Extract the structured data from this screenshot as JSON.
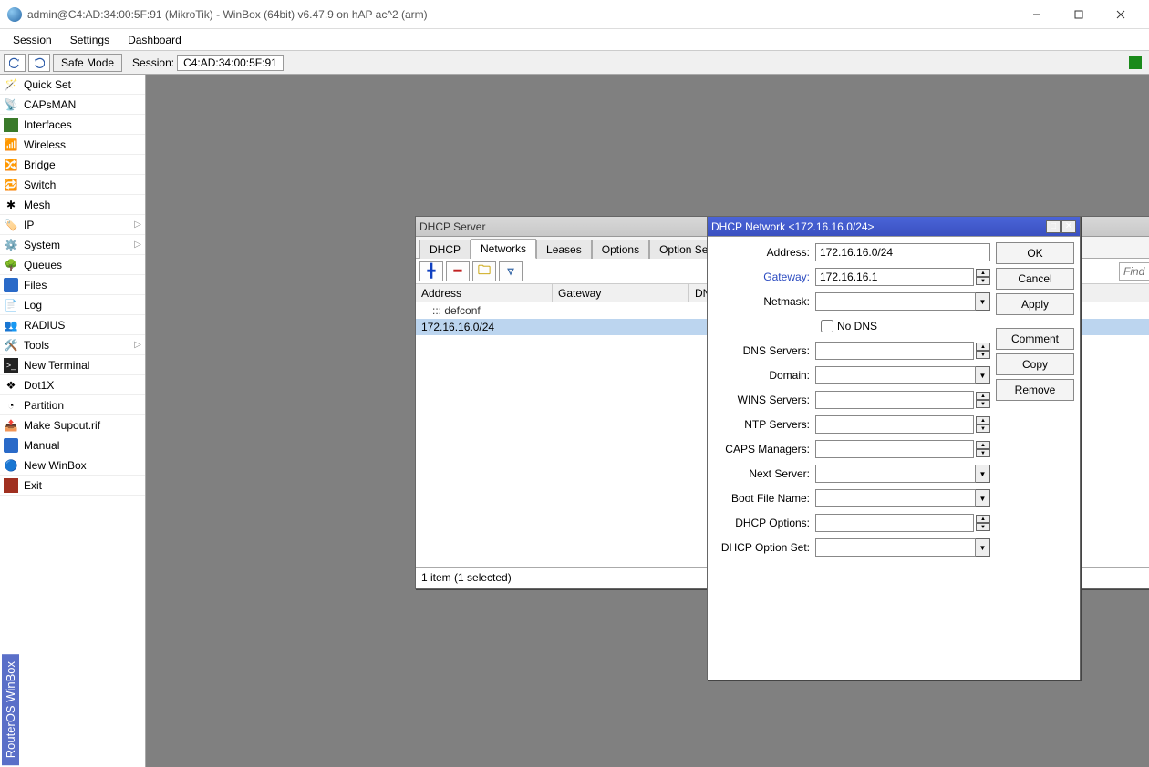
{
  "titlebar": {
    "title": "admin@C4:AD:34:00:5F:91 (MikroTik) - WinBox (64bit) v6.47.9 on hAP ac^2 (arm)"
  },
  "menubar": {
    "session": "Session",
    "settings": "Settings",
    "dashboard": "Dashboard"
  },
  "toolbar": {
    "safe_mode": "Safe Mode",
    "session_label": "Session:",
    "session_value": "C4:AD:34:00:5F:91"
  },
  "sidebar": {
    "items": [
      "Quick Set",
      "CAPsMAN",
      "Interfaces",
      "Wireless",
      "Bridge",
      "Switch",
      "Mesh",
      "IP",
      "System",
      "Queues",
      "Files",
      "Log",
      "RADIUS",
      "Tools",
      "New Terminal",
      "Dot1X",
      "Partition",
      "Make Supout.rif",
      "Manual",
      "New WinBox",
      "Exit"
    ],
    "vertical_label": "RouterOS WinBox"
  },
  "dhcp_window": {
    "title": "DHCP Server",
    "tabs": [
      "DHCP",
      "Networks",
      "Leases",
      "Options",
      "Option Sets"
    ],
    "active_tab": 1,
    "find_placeholder": "Find",
    "columns": [
      "Address",
      "Gateway",
      "DNS S"
    ],
    "rows": [
      {
        "comment": "::: defconf",
        "address": "",
        "gateway": "",
        "dns": ""
      },
      {
        "address": "172.16.16.0/24",
        "gateway": "",
        "dns": ""
      }
    ],
    "status": "1 item (1 selected)"
  },
  "dlg": {
    "title": "DHCP Network <172.16.16.0/24>",
    "fields": {
      "address_label": "Address:",
      "address": "172.16.16.0/24",
      "gateway_label": "Gateway:",
      "gateway": "172.16.16.1",
      "netmask_label": "Netmask:",
      "netmask": "",
      "nodns_label": "No DNS",
      "dns_label": "DNS Servers:",
      "dns": "",
      "domain_label": "Domain:",
      "domain": "",
      "wins_label": "WINS Servers:",
      "wins": "",
      "ntp_label": "NTP Servers:",
      "ntp": "",
      "caps_label": "CAPS Managers:",
      "caps": "",
      "next_label": "Next Server:",
      "next": "",
      "boot_label": "Boot File Name:",
      "boot": "",
      "opts_label": "DHCP Options:",
      "opts": "",
      "optset_label": "DHCP Option Set:",
      "optset": ""
    },
    "buttons": {
      "ok": "OK",
      "cancel": "Cancel",
      "apply": "Apply",
      "comment": "Comment",
      "copy": "Copy",
      "remove": "Remove"
    }
  }
}
